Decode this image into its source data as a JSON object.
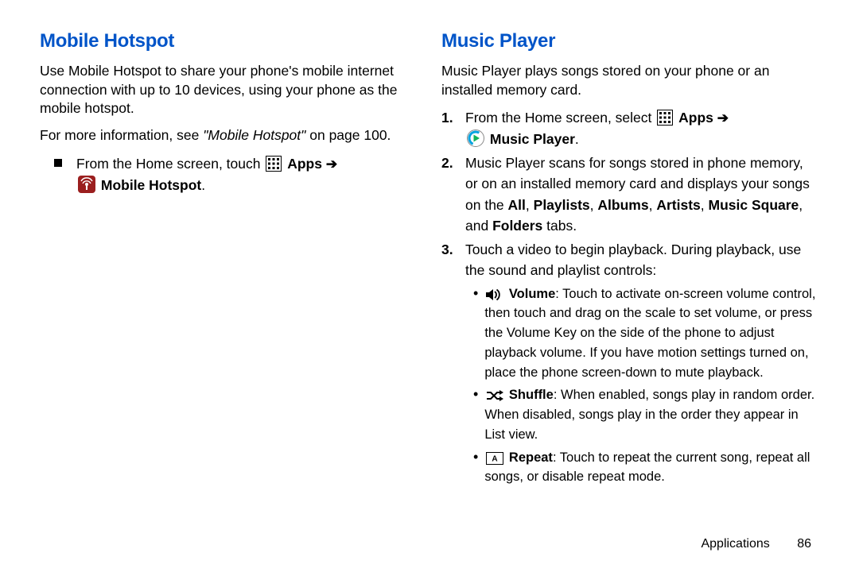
{
  "left": {
    "title": "Mobile Hotspot",
    "intro": "Use Mobile Hotspot to share your phone's mobile internet connection with up to 10 devices, using your phone as the mobile hotspot.",
    "moreinfo_pre": "For more information, see ",
    "moreinfo_ref": "\"Mobile Hotspot\"",
    "moreinfo_post": " on page 100.",
    "step_pre": "From the Home screen, touch ",
    "apps_label": "Apps",
    "hotspot_label": "Mobile Hotspot",
    "period": "."
  },
  "right": {
    "title": "Music Player",
    "intro": "Music Player plays songs stored on your phone or an installed memory card.",
    "step1_pre": "From the Home screen, select ",
    "apps_label": "Apps",
    "mp_label": "Music Player",
    "step2_a": "Music Player scans for songs stored in phone memory, or on an installed memory card and displays your songs on the ",
    "tabs_all": "All",
    "sep": ", ",
    "tabs_playlists": "Playlists",
    "tabs_albums": "Albums",
    "tabs_artists": "Artists",
    "tabs_music_square": "Music Square",
    "and_word": ", and ",
    "tabs_folders": "Folders",
    "step2_b": " tabs.",
    "step3": "Touch a video to begin playback. During playback, use the sound and playlist controls:",
    "volume_label": "Volume",
    "volume_text": ": Touch to activate on-screen volume control, then touch and drag on the scale to set volume, or press the Volume Key on the side of the phone to adjust playback volume. If you have motion settings turned on, place the phone screen-down to mute playback.",
    "shuffle_label": "Shuffle",
    "shuffle_text": ": When enabled, songs play in random order. When disabled, songs play in the order they appear in List view.",
    "repeat_label": "Repeat",
    "repeat_text": ": Touch to repeat the current song, repeat all songs, or disable repeat mode."
  },
  "footer": {
    "section": "Applications",
    "page": "86"
  },
  "num1": "1.",
  "num2": "2.",
  "num3": "3."
}
